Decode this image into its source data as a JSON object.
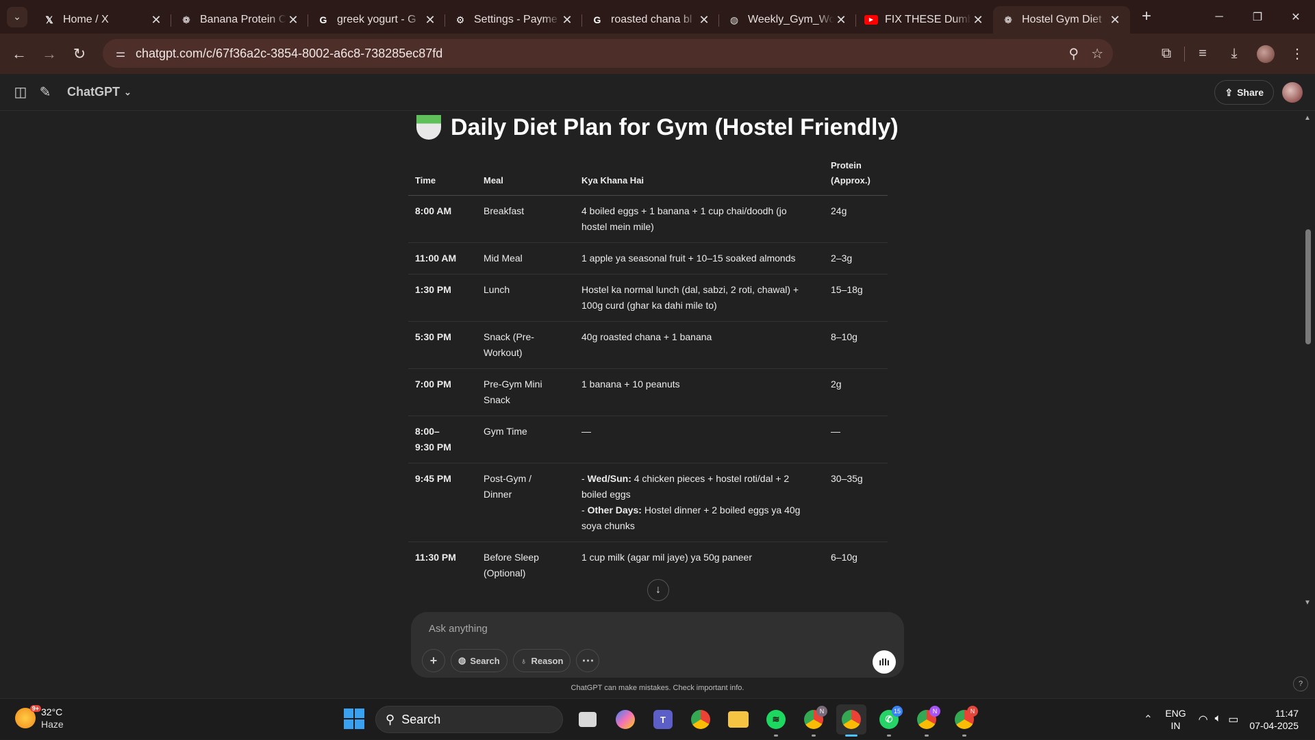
{
  "browser": {
    "tabs": [
      {
        "title": "Home / X",
        "icon": "x-logo-icon"
      },
      {
        "title": "Banana Protein C",
        "icon": "chatgpt-icon"
      },
      {
        "title": "greek yogurt - G",
        "icon": "google-icon"
      },
      {
        "title": "Settings - Payme",
        "icon": "gear-icon"
      },
      {
        "title": "roasted chana bl",
        "icon": "google-icon"
      },
      {
        "title": "Weekly_Gym_Wo",
        "icon": "globe-icon"
      },
      {
        "title": "FIX THESE Dumb",
        "icon": "youtube-icon"
      },
      {
        "title": "Hostel Gym Diet",
        "icon": "chatgpt-icon",
        "active": true
      }
    ],
    "url": "chatgpt.com/c/67f36a2c-3854-8002-a6c8-738285ec87fd"
  },
  "app": {
    "model_label": "ChatGPT",
    "share_label": "Share"
  },
  "content": {
    "heading": "Daily Diet Plan for Gym (Hostel Friendly)",
    "table": {
      "headers": {
        "time": "Time",
        "meal": "Meal",
        "food": "Kya Khana Hai",
        "protein_line1": "Protein",
        "protein_line2": "(Approx.)"
      },
      "rows": [
        {
          "time": "8:00 AM",
          "meal": "Breakfast",
          "food": "4 boiled eggs + 1 banana + 1 cup chai/doodh (jo hostel mein mile)",
          "protein": "24g"
        },
        {
          "time": "11:00 AM",
          "meal": "Mid Meal",
          "food": "1 apple ya seasonal fruit + 10–15 soaked almonds",
          "protein": "2–3g"
        },
        {
          "time": "1:30 PM",
          "meal": "Lunch",
          "food": "Hostel ka normal lunch (dal, sabzi, 2 roti, chawal) + 100g curd (ghar ka dahi mile to)",
          "protein": "15–18g"
        },
        {
          "time": "5:30 PM",
          "meal": "Snack (Pre-Workout)",
          "food": "40g roasted chana + 1 banana",
          "protein": "8–10g"
        },
        {
          "time": "7:00 PM",
          "meal": "Pre-Gym Mini Snack",
          "food": "1 banana + 10 peanuts",
          "protein": "2g"
        },
        {
          "time": "8:00–9:30 PM",
          "meal": "Gym Time",
          "food": "—",
          "protein": "—"
        },
        {
          "time": "9:45 PM",
          "meal": "Post-Gym / Dinner",
          "food_wed_label": "Wed/Sun:",
          "food_wed": "4 chicken pieces + hostel roti/dal + 2 boiled eggs",
          "food_other_label": "Other Days:",
          "food_other": "Hostel dinner + 2 boiled eggs ya 40g soya chunks",
          "protein": "30–35g"
        },
        {
          "time": "11:30 PM",
          "meal": "Before Sleep (Optional)",
          "food": "1 cup milk (agar mil jaye) ya 50g paneer",
          "protein": "6–10g"
        }
      ]
    }
  },
  "composer": {
    "placeholder": "Ask anything",
    "search_label": "Search",
    "reason_label": "Reason",
    "disclaimer": "ChatGPT can make mistakes. Check important info."
  },
  "taskbar": {
    "weather_badge": "9+",
    "temperature": "32°C",
    "condition": "Haze",
    "search_label": "Search",
    "whatsapp_badge": "15",
    "profile_badge": "N",
    "lang_line1": "ENG",
    "lang_line2": "IN",
    "time": "11:47",
    "date": "07-04-2025"
  }
}
